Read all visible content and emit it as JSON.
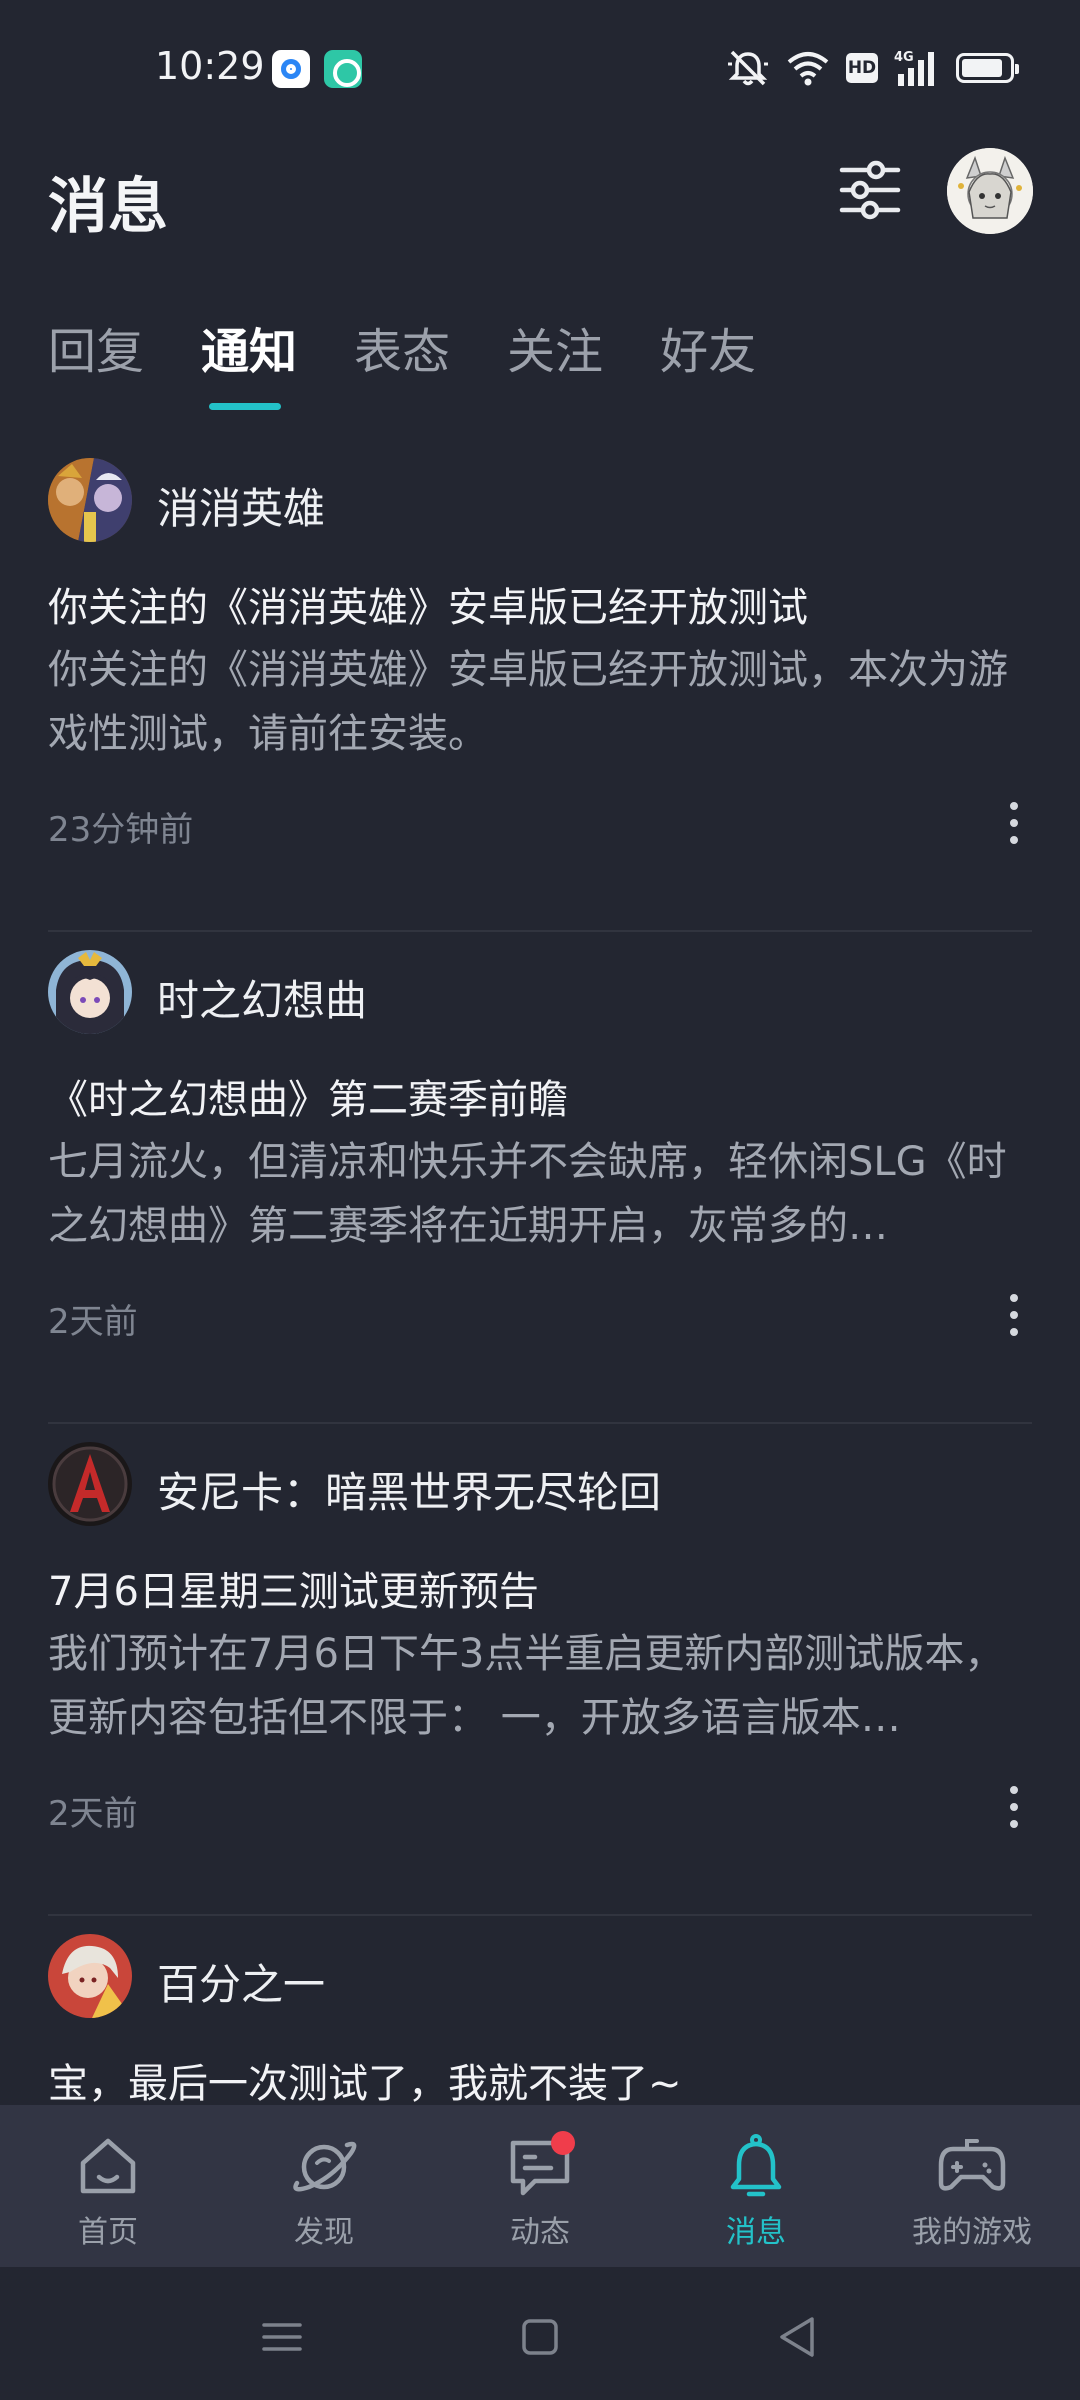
{
  "status_bar": {
    "time": "10:29",
    "icons": [
      "app-notification-icon",
      "app-notification-icon",
      "mute-icon",
      "wifi-icon",
      "hd-icon",
      "signal-4g-icon",
      "battery-icon"
    ],
    "hd": "HD",
    "network": "4G"
  },
  "header": {
    "title": "消息",
    "filter_icon": "filter-sliders-icon",
    "avatar_icon": "user-avatar"
  },
  "tabs": [
    {
      "label": "回复"
    },
    {
      "label": "通知"
    },
    {
      "label": "表态"
    },
    {
      "label": "关注"
    },
    {
      "label": "好友"
    }
  ],
  "active_tab": "通知",
  "colors": {
    "background": "#232631",
    "accent": "#23c2c9",
    "nav_background": "#323544",
    "badge_red": "#f03d4b"
  },
  "notifications": [
    {
      "game": "消消英雄",
      "title": "你关注的《消消英雄》安卓版已经开放测试",
      "body": "你关注的《消消英雄》安卓版已经开放测试，本次为游戏性测试，请前往安装。",
      "time": "23分钟前"
    },
    {
      "game": "时之幻想曲",
      "title": "《时之幻想曲》第二赛季前瞻",
      "body": "七月流火，但清凉和快乐并不会缺席，轻休闲SLG《时之幻想曲》第二赛季将在近期开启，灰常多的…",
      "time": "2天前"
    },
    {
      "game": "安尼卡：暗黑世界无尽轮回",
      "title": "7月6日星期三测试更新预告",
      "body": "我们预计在7月6日下午3点半重启更新内部测试版本，更新内容包括但不限于： 一，开放多语言版本…",
      "time": "2天前"
    },
    {
      "game": "百分之一",
      "title": "宝，最后一次测试了，我就不装了~",
      "body": "",
      "time": ""
    }
  ],
  "bottom_nav": [
    {
      "label": "首页",
      "icon": "home-icon"
    },
    {
      "label": "发现",
      "icon": "planet-icon"
    },
    {
      "label": "动态",
      "icon": "chat-icon"
    },
    {
      "label": "消息",
      "icon": "bell-icon"
    },
    {
      "label": "我的游戏",
      "icon": "gamepad-icon"
    }
  ],
  "active_nav": "消息"
}
